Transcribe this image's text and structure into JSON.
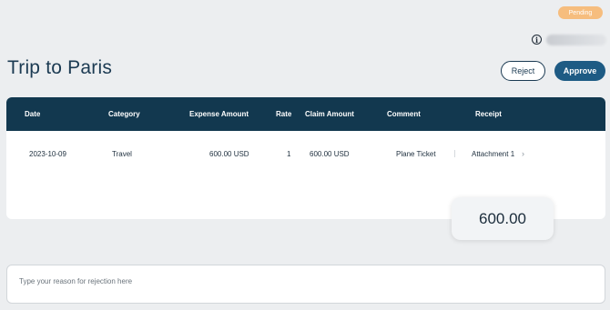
{
  "status_badge": "Pending",
  "header": {
    "title": "Trip to Paris",
    "reject_label": "Reject",
    "approve_label": "Approve"
  },
  "table": {
    "columns": [
      "Date",
      "Category",
      "Expense Amount",
      "Rate",
      "Claim Amount",
      "Comment",
      "Receipt"
    ],
    "rows": [
      {
        "date": "2023-10-09",
        "category": "Travel",
        "expense_amount": "600.00 USD",
        "rate": "1",
        "claim_amount": "600.00 USD",
        "comment": "Plane Ticket",
        "receipt": "Attachment 1"
      }
    ]
  },
  "total": "600.00",
  "rejection": {
    "placeholder": "Type your reason for rejection here",
    "value": ""
  },
  "icons": {
    "info": "info-icon",
    "receipt_chevron": "chevron-right-icon"
  },
  "colors": {
    "pending": "#f6bd7e",
    "table_header": "#12384f",
    "approve": "#1e5b84"
  }
}
